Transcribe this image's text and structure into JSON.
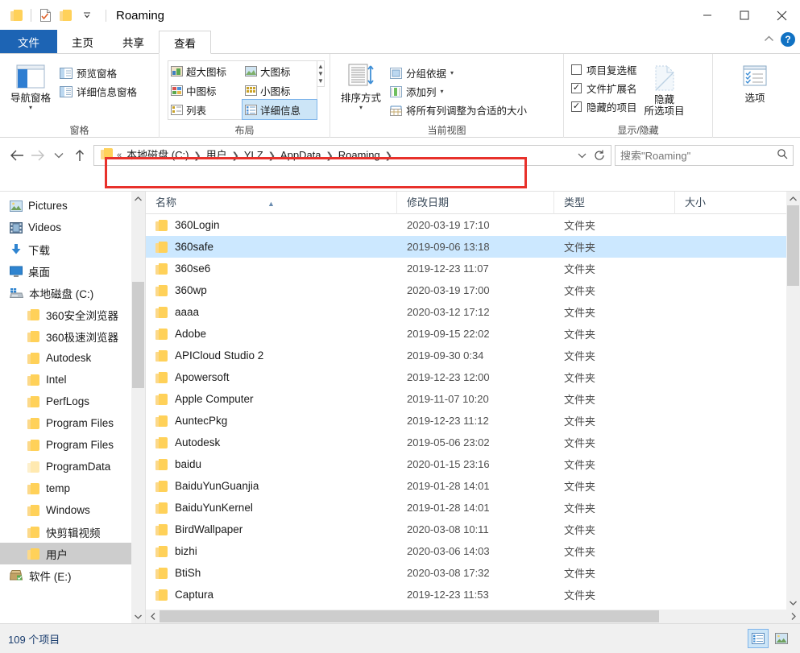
{
  "window": {
    "title": "Roaming",
    "quick_access": [
      {
        "name": "folder-icon",
        "label": "文件资源管理器"
      },
      {
        "name": "properties-icon",
        "label": "属性"
      },
      {
        "name": "new-folder-icon",
        "label": "新建文件夹"
      },
      {
        "name": "customize-dropdown-icon",
        "label": "自定义快速访问工具栏"
      }
    ],
    "controls": {
      "minimize": "—",
      "maximize": "☐",
      "close": "✕"
    }
  },
  "ribbon": {
    "tabs": [
      {
        "label": "文件",
        "kind": "file"
      },
      {
        "label": "主页",
        "kind": "normal"
      },
      {
        "label": "共享",
        "kind": "normal"
      },
      {
        "label": "查看",
        "kind": "active"
      }
    ],
    "collapse_label": "^",
    "help_label": "?",
    "groups": [
      {
        "label": "窗格",
        "big_button": {
          "label": "导航窗格",
          "has_dropdown": true
        },
        "items": [
          {
            "label": "预览窗格"
          },
          {
            "label": "详细信息窗格"
          }
        ]
      },
      {
        "label": "布局",
        "gallery": [
          {
            "label": "超大图标",
            "selected": false
          },
          {
            "label": "大图标",
            "selected": false
          },
          {
            "label": "中图标",
            "selected": false
          },
          {
            "label": "小图标",
            "selected": false
          },
          {
            "label": "列表",
            "selected": false
          },
          {
            "label": "详细信息",
            "selected": true
          }
        ]
      },
      {
        "label": "当前视图",
        "big_button": {
          "label": "排序方式",
          "has_dropdown": true
        },
        "items": [
          {
            "label": "分组依据",
            "has_dropdown": true
          },
          {
            "label": "添加列",
            "has_dropdown": true
          },
          {
            "label": "将所有列调整为合适的大小",
            "has_dropdown": false
          }
        ]
      },
      {
        "label": "显示/隐藏",
        "checkboxes": [
          {
            "label": "项目复选框",
            "checked": false
          },
          {
            "label": "文件扩展名",
            "checked": true
          },
          {
            "label": "隐藏的项目",
            "checked": true
          }
        ],
        "hide_button": {
          "line1": "隐藏",
          "line2": "所选项目",
          "disabled": true
        }
      },
      {
        "label": "",
        "options_button": {
          "label": "选项"
        }
      }
    ]
  },
  "address": {
    "back_label": "←",
    "forward_label": "→",
    "recent_label": "⌄",
    "up_label": "↑",
    "prefix": "«",
    "crumbs": [
      "本地磁盘 (C:)",
      "用户",
      "YLZ",
      "AppData",
      "Roaming"
    ],
    "dropdown_label": "⌄",
    "refresh_label": "↻",
    "highlighted": true
  },
  "search": {
    "placeholder": "搜索\"Roaming\"",
    "icon": "search-icon"
  },
  "sidebar": {
    "items": [
      {
        "label": "Pictures",
        "icon": "pictures-icon",
        "indent": false,
        "selected": false,
        "dim": false
      },
      {
        "label": "Videos",
        "icon": "videos-icon",
        "indent": false,
        "selected": false,
        "dim": false
      },
      {
        "label": "下载",
        "icon": "downloads-icon",
        "indent": false,
        "selected": false,
        "dim": false
      },
      {
        "label": "桌面",
        "icon": "desktop-icon",
        "indent": false,
        "selected": false,
        "dim": false
      },
      {
        "label": "本地磁盘 (C:)",
        "icon": "drive-icon",
        "indent": false,
        "selected": false,
        "dim": false
      },
      {
        "label": "360安全浏览器",
        "icon": "folder-icon",
        "indent": true,
        "selected": false,
        "dim": false
      },
      {
        "label": "360极速浏览器",
        "icon": "folder-icon",
        "indent": true,
        "selected": false,
        "dim": false
      },
      {
        "label": "Autodesk",
        "icon": "folder-icon",
        "indent": true,
        "selected": false,
        "dim": false
      },
      {
        "label": "Intel",
        "icon": "folder-icon",
        "indent": true,
        "selected": false,
        "dim": false
      },
      {
        "label": "PerfLogs",
        "icon": "folder-icon",
        "indent": true,
        "selected": false,
        "dim": false
      },
      {
        "label": "Program Files",
        "icon": "folder-icon",
        "indent": true,
        "selected": false,
        "dim": false
      },
      {
        "label": "Program Files",
        "icon": "folder-icon",
        "indent": true,
        "selected": false,
        "dim": false
      },
      {
        "label": "ProgramData",
        "icon": "folder-icon",
        "indent": true,
        "selected": false,
        "dim": true
      },
      {
        "label": "temp",
        "icon": "folder-icon",
        "indent": true,
        "selected": false,
        "dim": false
      },
      {
        "label": "Windows",
        "icon": "folder-icon",
        "indent": true,
        "selected": false,
        "dim": false
      },
      {
        "label": "快剪辑视频",
        "icon": "folder-icon",
        "indent": true,
        "selected": false,
        "dim": false
      },
      {
        "label": "用户",
        "icon": "folder-icon",
        "indent": true,
        "selected": true,
        "dim": false
      },
      {
        "label": "软件 (E:)",
        "icon": "drive-e-icon",
        "indent": false,
        "selected": false,
        "dim": false
      }
    ]
  },
  "filelist": {
    "columns": [
      {
        "label": "名称",
        "sorted": "asc"
      },
      {
        "label": "修改日期",
        "sorted": null
      },
      {
        "label": "类型",
        "sorted": null
      },
      {
        "label": "大小",
        "sorted": null
      }
    ],
    "rows": [
      {
        "name": "360Login",
        "date": "2020-03-19 17:10",
        "type": "文件夹",
        "size": "",
        "selected": false
      },
      {
        "name": "360safe",
        "date": "2019-09-06 13:18",
        "type": "文件夹",
        "size": "",
        "selected": true
      },
      {
        "name": "360se6",
        "date": "2019-12-23 11:07",
        "type": "文件夹",
        "size": "",
        "selected": false
      },
      {
        "name": "360wp",
        "date": "2020-03-19 17:00",
        "type": "文件夹",
        "size": "",
        "selected": false
      },
      {
        "name": "aaaa",
        "date": "2020-03-12 17:12",
        "type": "文件夹",
        "size": "",
        "selected": false
      },
      {
        "name": "Adobe",
        "date": "2019-09-15 22:02",
        "type": "文件夹",
        "size": "",
        "selected": false
      },
      {
        "name": "APICloud Studio 2",
        "date": "2019-09-30 0:34",
        "type": "文件夹",
        "size": "",
        "selected": false
      },
      {
        "name": "Apowersoft",
        "date": "2019-12-23 12:00",
        "type": "文件夹",
        "size": "",
        "selected": false
      },
      {
        "name": "Apple Computer",
        "date": "2019-11-07 10:20",
        "type": "文件夹",
        "size": "",
        "selected": false
      },
      {
        "name": "AuntecPkg",
        "date": "2019-12-23 11:12",
        "type": "文件夹",
        "size": "",
        "selected": false
      },
      {
        "name": "Autodesk",
        "date": "2019-05-06 23:02",
        "type": "文件夹",
        "size": "",
        "selected": false
      },
      {
        "name": "baidu",
        "date": "2020-01-15 23:16",
        "type": "文件夹",
        "size": "",
        "selected": false
      },
      {
        "name": "BaiduYunGuanjia",
        "date": "2019-01-28 14:01",
        "type": "文件夹",
        "size": "",
        "selected": false
      },
      {
        "name": "BaiduYunKernel",
        "date": "2019-01-28 14:01",
        "type": "文件夹",
        "size": "",
        "selected": false
      },
      {
        "name": "BirdWallpaper",
        "date": "2020-03-08 10:11",
        "type": "文件夹",
        "size": "",
        "selected": false
      },
      {
        "name": "bizhi",
        "date": "2020-03-06 14:03",
        "type": "文件夹",
        "size": "",
        "selected": false
      },
      {
        "name": "BtiSh",
        "date": "2020-03-08 17:32",
        "type": "文件夹",
        "size": "",
        "selected": false
      },
      {
        "name": "Captura",
        "date": "2019-12-23 11:53",
        "type": "文件夹",
        "size": "",
        "selected": false
      }
    ]
  },
  "statusbar": {
    "item_count": "109 个项目",
    "views": [
      {
        "name": "details-view",
        "selected": true
      },
      {
        "name": "large-icons-view",
        "selected": false
      }
    ]
  },
  "colors": {
    "file_tab": "#1d64b4",
    "selection": "#cce8ff",
    "tree_selection": "#cdcdcd",
    "highlight_box": "#e8312b",
    "folder": "#ffd159"
  }
}
